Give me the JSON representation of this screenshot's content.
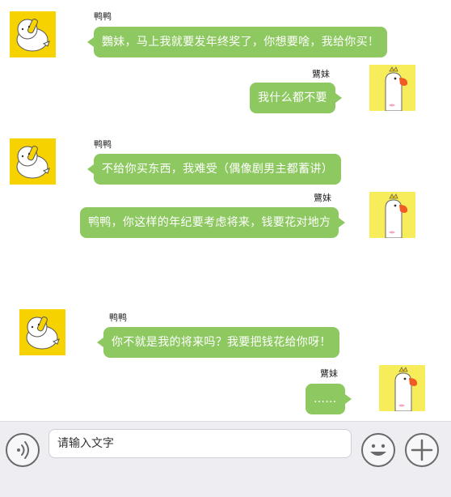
{
  "colors": {
    "bubble": "#8dc860",
    "bubble_text": "#ffffff",
    "avatar_left_bg": "#f6d200",
    "avatar_right_bg": "#f7ec5a",
    "input_bar_bg": "#eeeef2"
  },
  "icons": {
    "voice": "voice-icon",
    "emoji": "emoji-icon",
    "plus": "plus-icon"
  },
  "messages": [
    {
      "side": "left",
      "sender": "鸭鸭",
      "text": "鸚妹，马上我就要发年终奖了，你想要啥，我给你买！"
    },
    {
      "side": "right",
      "sender": "鸗妹",
      "text": "我什么都不要"
    },
    {
      "side": "left",
      "sender": "鸭鸭",
      "text": "不给你买东西，我难受（偶像剧男主都蓄讲）"
    },
    {
      "side": "right",
      "sender": "鸗妹",
      "text": "鸭鸭，你这样的年纪要考虑将来，钱要花对地方"
    },
    {
      "side": "left",
      "sender": "鸭鸭",
      "text": "你不就是我的将来吗？我要把钱花给你呀！"
    },
    {
      "side": "right",
      "sender": "鸗妹",
      "text": "……"
    }
  ],
  "input": {
    "placeholder": "请输入文字",
    "value": ""
  }
}
